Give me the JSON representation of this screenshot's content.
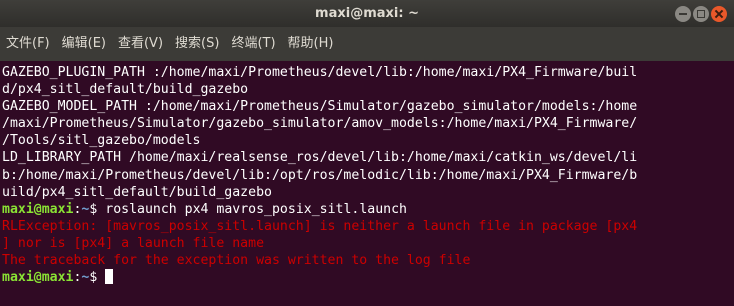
{
  "window": {
    "title": "maxi@maxi: ~"
  },
  "menu": [
    "文件(F)",
    "编辑(E)",
    "查看(V)",
    "搜索(S)",
    "终端(T)",
    "帮助(H)"
  ],
  "terminal": {
    "output_lines": [
      "GAZEBO_PLUGIN_PATH :/home/maxi/Prometheus/devel/lib:/home/maxi/PX4_Firmware/buil",
      "d/px4_sitl_default/build_gazebo",
      "GAZEBO_MODEL_PATH :/home/maxi/Prometheus/Simulator/gazebo_simulator/models:/home",
      "/maxi/Prometheus/Simulator/gazebo_simulator/amov_models:/home/maxi/PX4_Firmware/",
      "/Tools/sitl_gazebo/models",
      "LD_LIBRARY_PATH /home/maxi/realsense_ros/devel/lib:/home/maxi/catkin_ws/devel/li",
      "b:/home/maxi/Prometheus/devel/lib:/opt/ros/melodic/lib:/home/maxi/PX4_Firmware/b",
      "uild/px4_sitl_default/build_gazebo"
    ],
    "prompt": {
      "user_host": "maxi@maxi",
      "separator": ":",
      "path": "~",
      "symbol": "$ "
    },
    "command": "roslaunch px4 mavros_posix_sitl.launch",
    "error_lines": [
      "RLException: [mavros_posix_sitl.launch] is neither a launch file in package [px4",
      "] nor is [px4] a launch file name",
      "The traceback for the exception was written to the log file"
    ]
  },
  "colors": {
    "background": "#300a24",
    "prompt_user": "#8ae234",
    "prompt_path": "#729fcf",
    "error": "#cc0000"
  }
}
